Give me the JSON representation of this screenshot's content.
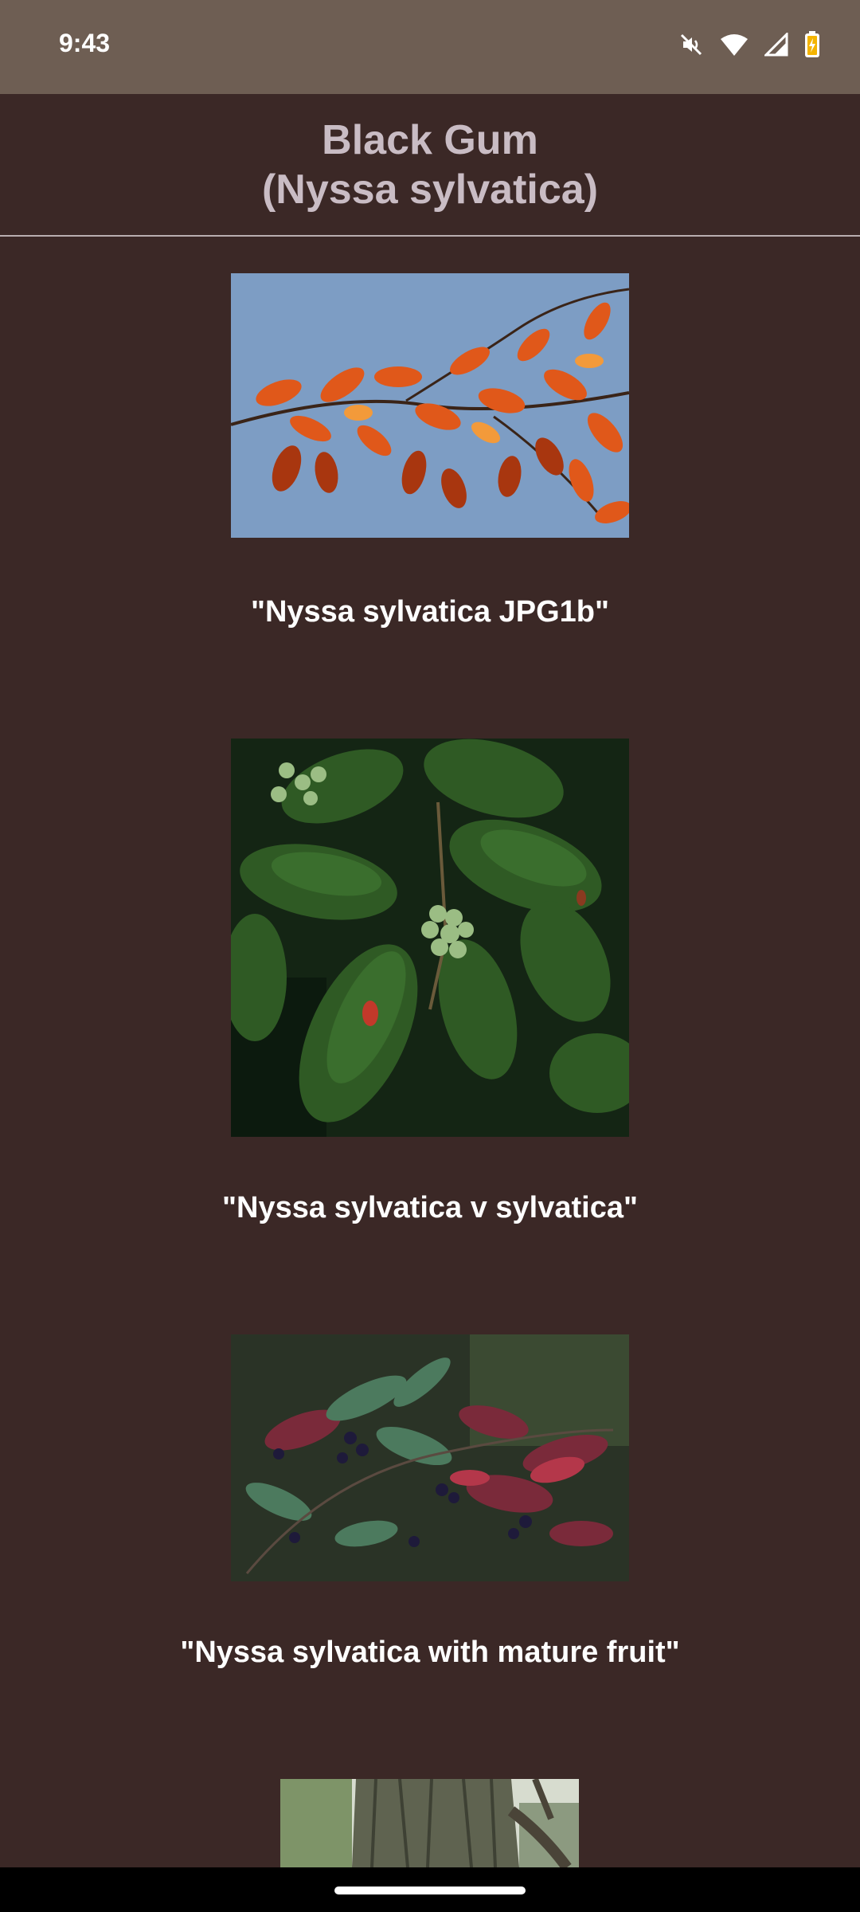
{
  "status_bar": {
    "time": "9:43",
    "icons": [
      "mute-icon",
      "wifi-icon",
      "signal-icon",
      "battery-icon"
    ]
  },
  "header": {
    "title_line1": "Black Gum",
    "title_line2": "(Nyssa sylvatica)"
  },
  "gallery": {
    "items": [
      {
        "caption": "\"Nyssa sylvatica JPG1b\"",
        "image": "autumn-leaves-photo"
      },
      {
        "caption": "\"Nyssa sylvatica v sylvatica\"",
        "image": "green-leaves-berries-photo"
      },
      {
        "caption": "\"Nyssa sylvatica with mature fruit\"",
        "image": "mature-fruit-photo"
      },
      {
        "caption": "",
        "image": "trunk-bark-photo"
      }
    ]
  },
  "colors": {
    "background": "#3b2826",
    "status_bar": "#6e5e53",
    "title": "#c9bcc4"
  }
}
